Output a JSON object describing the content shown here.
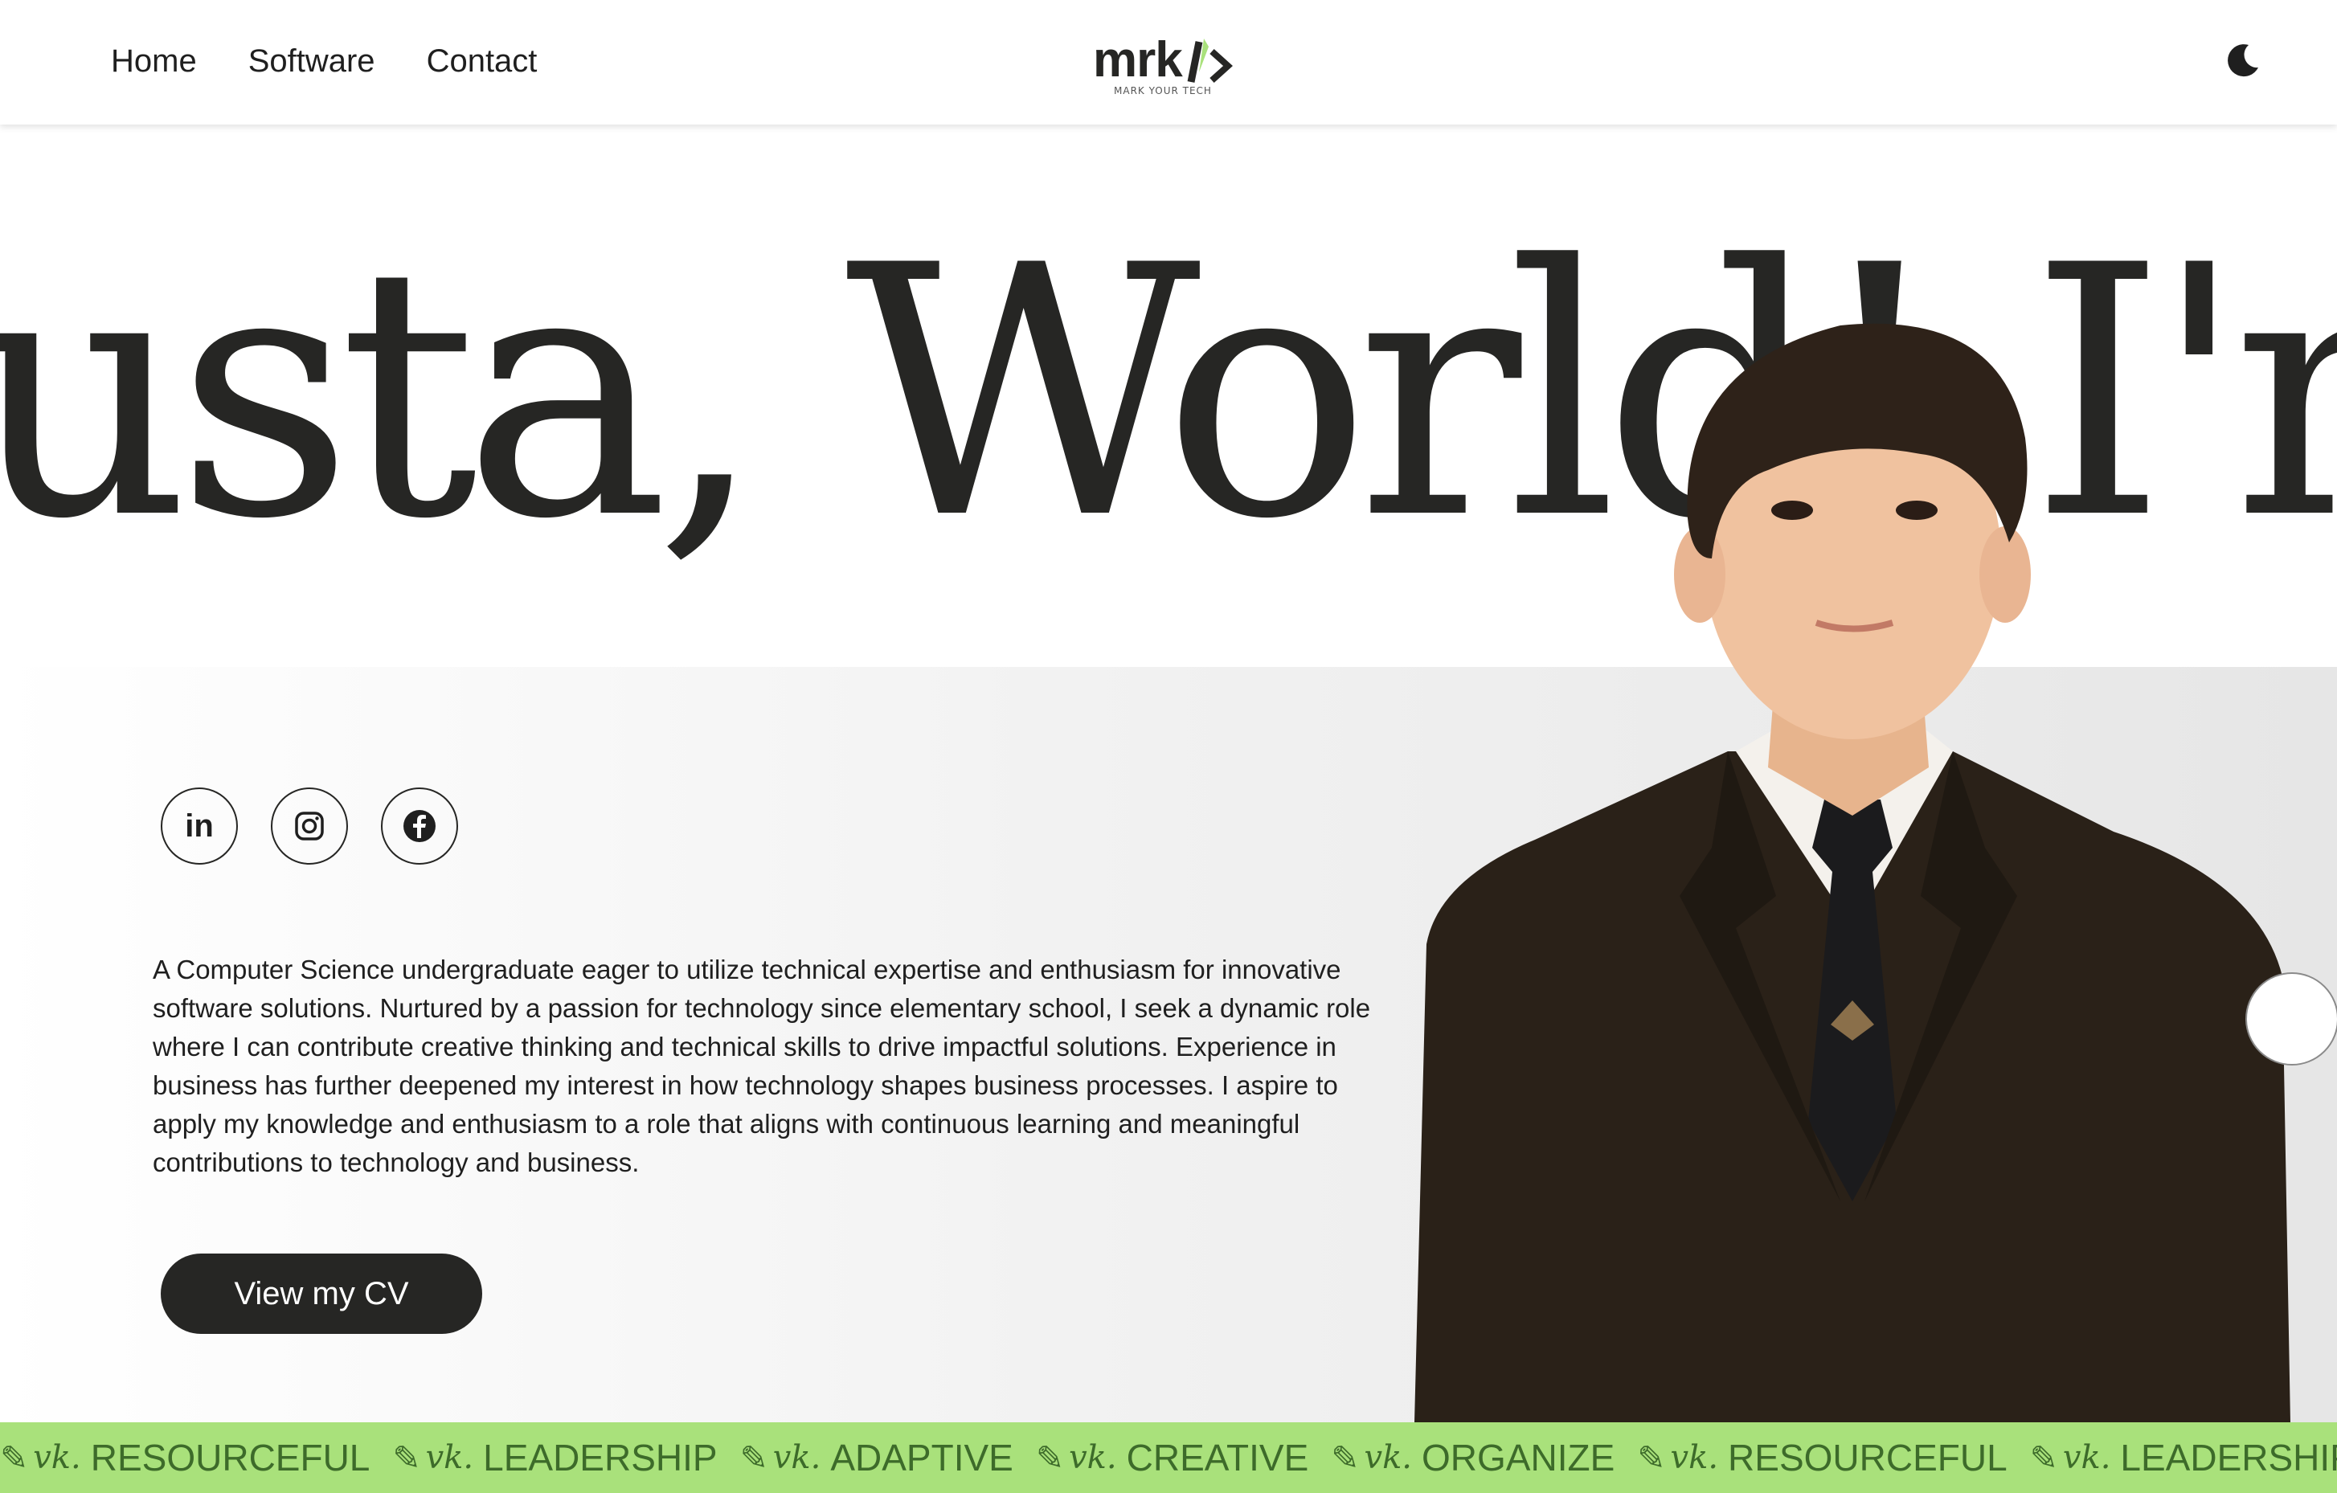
{
  "nav": {
    "links": [
      "Home",
      "Software",
      "Contact"
    ],
    "logo_text": "mrk",
    "logo_subtitle": "MARK YOUR TECH"
  },
  "hero": {
    "headline": "usta, World! I'm M"
  },
  "socials": [
    "in"
  ],
  "bio": "A Computer Science undergraduate eager to utilize technical expertise and enthusiasm for innovative software solutions. Nurtured by a passion for technology since elementary school, I seek a dynamic role where I can contribute creative thinking and technical skills to drive impactful solutions. Experience in business has further deepened my interest in how technology shapes business processes. I aspire to apply my knowledge and enthusiasm to a role that aligns with continuous learning and meaningful contributions to technology and business.",
  "cv_button": "View my CV",
  "marquee": {
    "tag": " ",
    "items": [
      "RESOURCEFUL",
      "LEADERSHIP",
      "ADAPTIVE",
      "CREATIVE",
      "ORGANIZE",
      "RESOURCEFUL",
      "LEADERSHIP"
    ]
  },
  "colors": {
    "dark": "#262624",
    "accent_green": "#a9e17b",
    "marquee_text": "#3d6b2a"
  }
}
